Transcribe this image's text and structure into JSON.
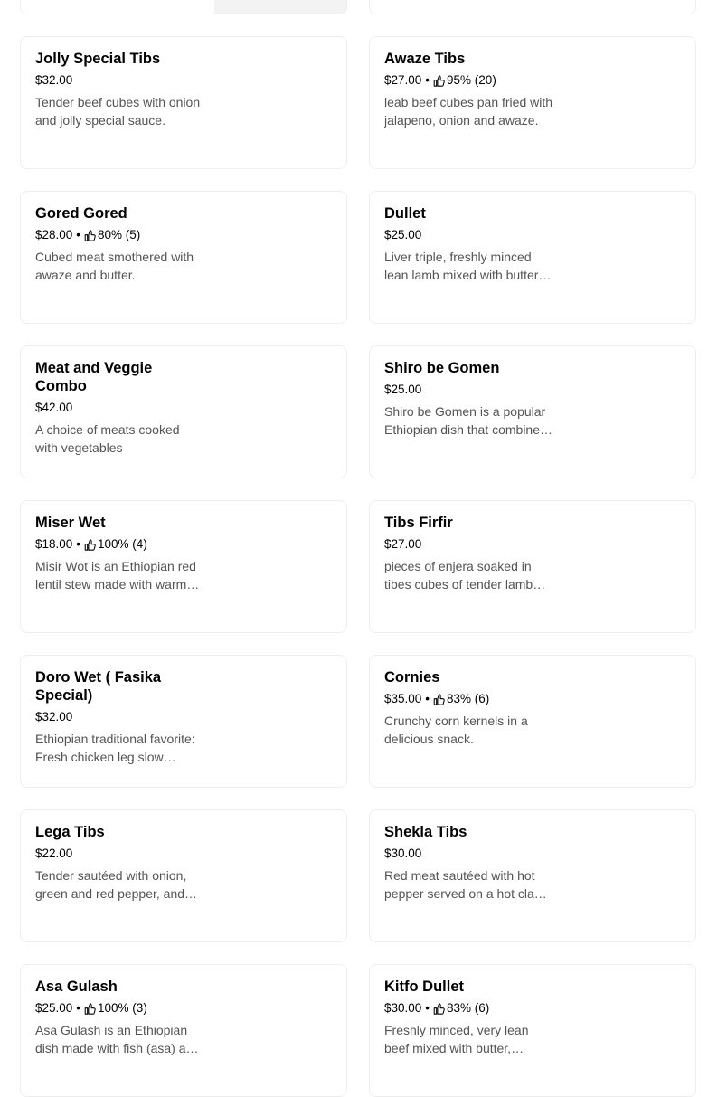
{
  "menu": {
    "items": [
      {
        "name": "Jolly Special Tibs",
        "price": "$32.00",
        "rating": "",
        "desc": "Tender beef cubes with onion and jolly special sauce."
      },
      {
        "name": "Awaze Tibs",
        "price": "$27.00",
        "rating": "95% (20)",
        "desc": "leab beef cubes pan fried with jalapeno, onion and awaze."
      },
      {
        "name": "Gored Gored",
        "price": "$28.00",
        "rating": "80% (5)",
        "desc": "Cubed meat smothered with awaze and butter."
      },
      {
        "name": "Dullet",
        "price": "$25.00",
        "rating": "",
        "desc": "Liver triple, freshly minced lean lamb mixed with butter and spices."
      },
      {
        "name": "Meat and Veggie Combo",
        "price": "$42.00",
        "rating": "",
        "desc": "A choice of meats cooked with vegetables"
      },
      {
        "name": "Shiro be Gomen",
        "price": "$25.00",
        "rating": "",
        "desc": "Shiro be Gomen is a popular Ethiopian dish that combines shiro and collard greens."
      },
      {
        "name": "Miser Wet",
        "price": "$18.00",
        "rating": "100% (4)",
        "desc": "Misir Wot is an Ethiopian red lentil stew made with warm berbere spices."
      },
      {
        "name": "Tibs Firfir",
        "price": "$27.00",
        "rating": "",
        "desc": "pieces of enjera soaked in tibes cubes of tender lamb and spiced butter."
      },
      {
        "name": "Doro Wet ( Fasika Special)",
        "price": "$32.00",
        "rating": "",
        "desc": "Ethiopian traditional favorite: Fresh chicken leg slow cooked in berbere sauce."
      },
      {
        "name": "Cornies",
        "price": "$35.00",
        "rating": "83% (6)",
        "desc": "Crunchy corn kernels in a delicious snack."
      },
      {
        "name": "Lega Tibs",
        "price": "$22.00",
        "rating": "",
        "desc": "Tender sautéed with onion, green and red pepper, and rosemary."
      },
      {
        "name": "Shekla Tibs",
        "price": "$30.00",
        "rating": "",
        "desc": "Red meat sautéed with hot pepper served on a hot clay pot."
      },
      {
        "name": "Asa Gulash",
        "price": "$25.00",
        "rating": "100% (3)",
        "desc": "Asa Gulash is an Ethiopian dish made with fish (asa) and spices."
      },
      {
        "name": "Kitfo Dullet",
        "price": "$30.00",
        "rating": "83% (6)",
        "desc": "Freshly minced, very lean beef mixed with butter, mitmita and spices."
      }
    ]
  }
}
